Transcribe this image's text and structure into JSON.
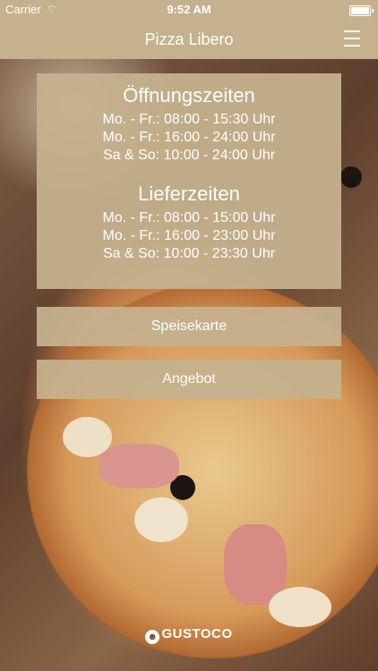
{
  "status": {
    "carrier": "Carrier",
    "time": "9:52 AM"
  },
  "nav": {
    "title": "Pizza Libero"
  },
  "hours": {
    "opening_title": "Öffnungszeiten",
    "opening_lines": [
      "Mo. - Fr.: 08:00 - 15:30 Uhr",
      "Mo. - Fr.: 16:00 - 24:00 Uhr",
      "Sa & So: 10:00 - 24:00 Uhr"
    ],
    "delivery_title": "Lieferzeiten",
    "delivery_lines": [
      "Mo. - Fr.: 08:00 - 15:00 Uhr",
      "Mo. - Fr.: 16:00 - 23:00 Uhr",
      "Sa & So: 10:00 - 23:30 Uhr"
    ]
  },
  "buttons": {
    "menu_label": "Speisekarte",
    "offer_label": "Angebot"
  },
  "footer": {
    "brand": "GUSTOCO"
  },
  "colors": {
    "accent": "#c5b18d",
    "text": "#ffffff"
  }
}
